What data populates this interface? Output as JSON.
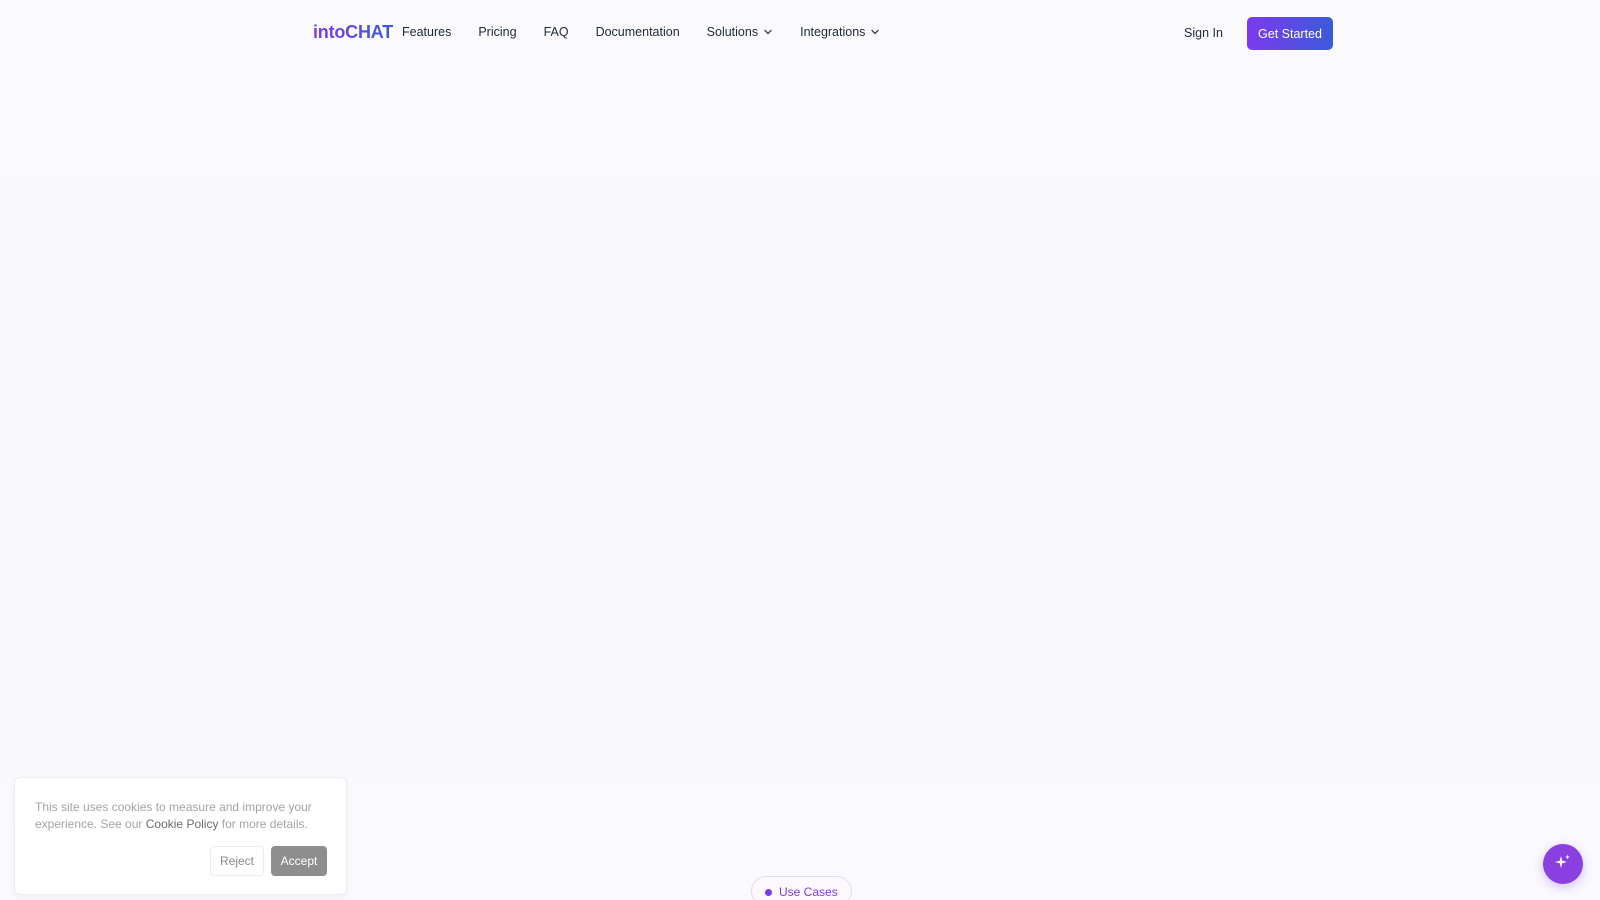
{
  "brand": {
    "name": "intoCHAT"
  },
  "nav": {
    "items": [
      {
        "label": "Features"
      },
      {
        "label": "Pricing"
      },
      {
        "label": "FAQ"
      },
      {
        "label": "Documentation"
      },
      {
        "label": "Solutions",
        "has_dropdown": true
      },
      {
        "label": "Integrations",
        "has_dropdown": true
      }
    ],
    "sign_in": "Sign In",
    "get_started": "Get Started"
  },
  "cookie_banner": {
    "text_before": "This site uses cookies to measure and improve your experience. See our ",
    "link_text": "Cookie Policy",
    "text_after": " for more details.",
    "reject_label": "Reject",
    "accept_label": "Accept"
  },
  "section_badge": {
    "label": "Use Cases"
  },
  "chat_fab": {
    "icon": "sparkles-icon"
  },
  "colors": {
    "accent_purple": "#7c3aed",
    "accent_blue": "#3b5bdb",
    "fab": "#8b3fe0",
    "accept_button": "#8e8e8e"
  }
}
